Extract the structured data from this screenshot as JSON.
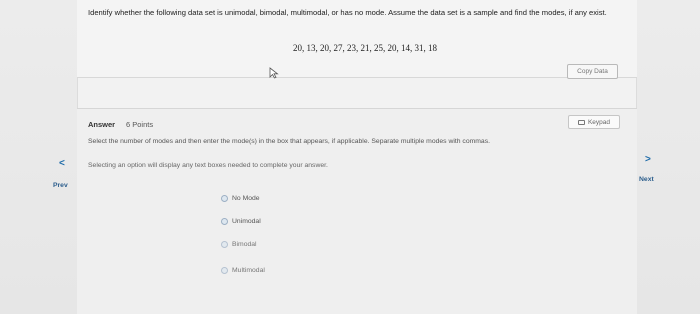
{
  "question": {
    "prompt": "Identify whether the following data set is unimodal, bimodal, multimodal, or has no mode. Assume the data set is a sample and find the modes, if any exist.",
    "dataset": "20, 13, 20, 27, 23, 21, 25, 20, 14, 31, 18",
    "copy_data_label": "Copy Data"
  },
  "answer": {
    "label": "Answer",
    "points": "6 Points",
    "keypad_label": "Keypad",
    "instruction": "Select the number of modes and then enter the mode(s) in the box that appears, if applicable. Separate multiple modes with commas.",
    "hint": "Selecting an option will display any text boxes needed to complete your answer.",
    "options": [
      "No Mode",
      "Unimodal",
      "Bimodal",
      "Multimodal"
    ]
  },
  "nav": {
    "prev_arrow": "<",
    "prev_label": "Prev",
    "next_arrow": ">",
    "next_label": "Next"
  }
}
